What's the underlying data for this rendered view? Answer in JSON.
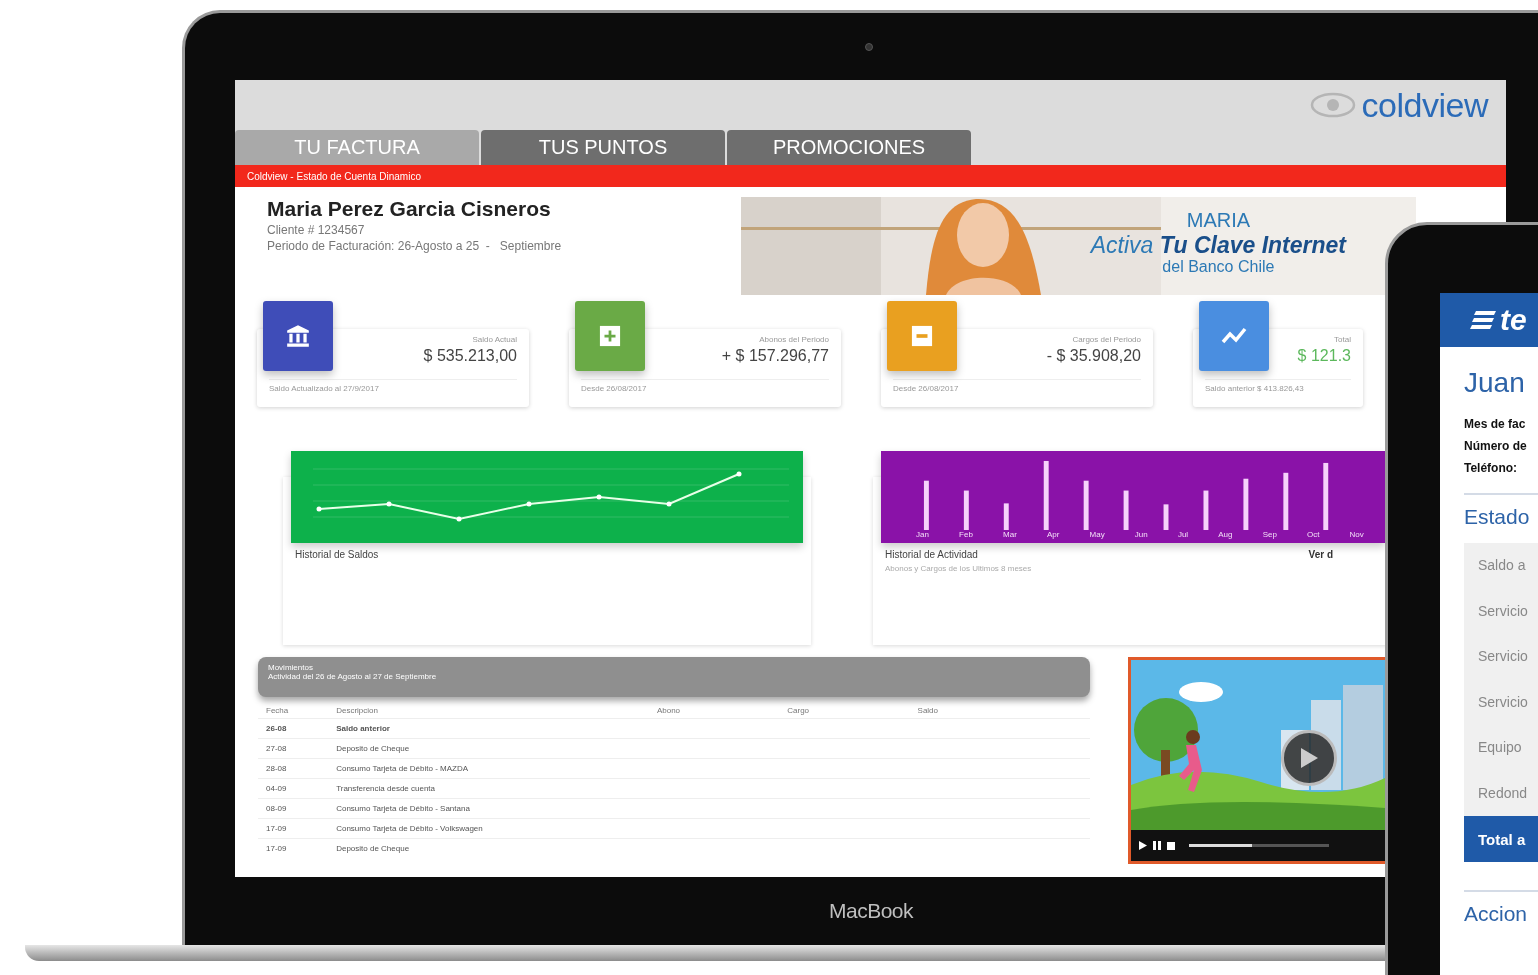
{
  "device_label": "MacBook",
  "app": {
    "logo": "coldview",
    "tabs": [
      {
        "label": "TU FACTURA",
        "selected": true
      },
      {
        "label": "TUS PUNTOS",
        "selected": false
      },
      {
        "label": "PROMOCIONES",
        "selected": false
      }
    ],
    "breadcrumb": "Coldview - Estado de Cuenta Dinamico",
    "customer": {
      "name": "Maria Perez Garcia Cisneros",
      "client": "Cliente # 1234567",
      "period": "Periodo de Facturación: 26-Agosto a 25  -   Septiembre"
    },
    "banner": {
      "kind": "picture",
      "greeting": "MARIA",
      "headline": "Activa **Tu Clave Internet**",
      "subline": "del Banco Chile"
    },
    "stats": [
      {
        "kind": "bank",
        "color": "#3f4db8",
        "label": "Saldo Actual",
        "amount": "$ 535.213,00",
        "note": "Saldo Actualizado al 27/9/2017"
      },
      {
        "kind": "plus",
        "color": "#6aaa46",
        "label": "Abonos del Periodo",
        "amount": "+ $ 157.296,77",
        "note": "Desde 26/08/2017"
      },
      {
        "kind": "minus",
        "color": "#e9a020",
        "label": "Cargos del Periodo",
        "amount": "- $ 35.908,20",
        "note": "Desde 26/08/2017"
      },
      {
        "kind": "trend",
        "color": "#4a8ee0",
        "label": "Total",
        "amount": "$ 121.3",
        "note": "Saldo anterior $ 413.826,43"
      }
    ],
    "charts": [
      {
        "kind": "line",
        "title": "Historial de Saldos"
      },
      {
        "kind": "bars",
        "title": "Historial de Actividad",
        "subtitle": "Abonos y Cargos de los Ultimos 8 meses",
        "link": "Ver d",
        "months": [
          "Jan",
          "Feb",
          "Mar",
          "Apr",
          "May",
          "Jun",
          "Jul",
          "Aug",
          "Sep",
          "Oct",
          "Nov"
        ]
      }
    ],
    "movements": {
      "title": "Movimientos",
      "subtitle": "Actividad del 26 de Agosto al 27 de Septiembre",
      "columns": [
        "Fecha",
        "Descripcion",
        "Abono",
        "Cargo",
        "Saldo"
      ],
      "rows": [
        {
          "date": "26-08",
          "description": "Saldo anterior",
          "emphasis": true
        },
        {
          "date": "27-08",
          "description": "Deposito de Cheque",
          "emphasis": false
        },
        {
          "date": "28-08",
          "description": "Consumo Tarjeta de Débito - MAZDA",
          "emphasis": false
        },
        {
          "date": "04-09",
          "description": "Transferencia desde cuenta",
          "emphasis": false
        },
        {
          "date": "08-09",
          "description": "Consumo Tarjeta de Débito - Santana",
          "emphasis": false
        },
        {
          "date": "17-09",
          "description": "Consumo Tarjeta de Débito - Volkswagen",
          "emphasis": false
        },
        {
          "date": "17-09",
          "description": "Deposito de Cheque",
          "emphasis": false
        }
      ]
    },
    "video": {
      "kind": "picture",
      "progress": {
        "level": 0.45
      }
    }
  },
  "tablet": {
    "logo": "te",
    "name": "Juan",
    "fields": [
      "Mes de fac",
      "Número de",
      "Teléfono:"
    ],
    "section": "Estado",
    "rows": [
      "Saldo a",
      "Servicio",
      "Servicio",
      "Servicio",
      "Equipo",
      "Redond"
    ],
    "total": "Total a",
    "next_section": "Accion"
  }
}
